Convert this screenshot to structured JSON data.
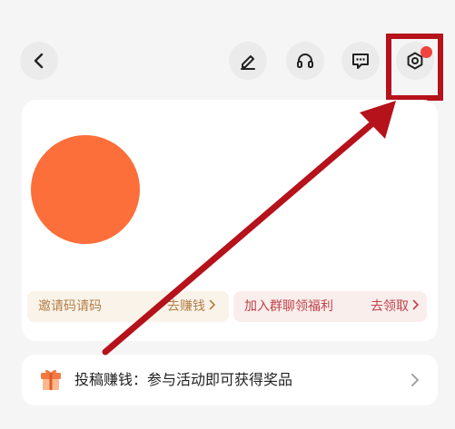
{
  "header": {
    "icons": [
      "back-icon",
      "edit-icon",
      "headset-icon",
      "message-icon",
      "settings-icon"
    ],
    "has_notification": true
  },
  "colors": {
    "avatar": "#fc6e3a",
    "highlight": "#b5121b",
    "notification": "#f0423e"
  },
  "profile": {
    "invite": {
      "label": "邀请码请码",
      "action": "去赚钱"
    },
    "group": {
      "label": "加入群聊领福利",
      "action": "去领取"
    }
  },
  "promo": {
    "text": "投稿赚钱：参与活动即可获得奖品"
  }
}
